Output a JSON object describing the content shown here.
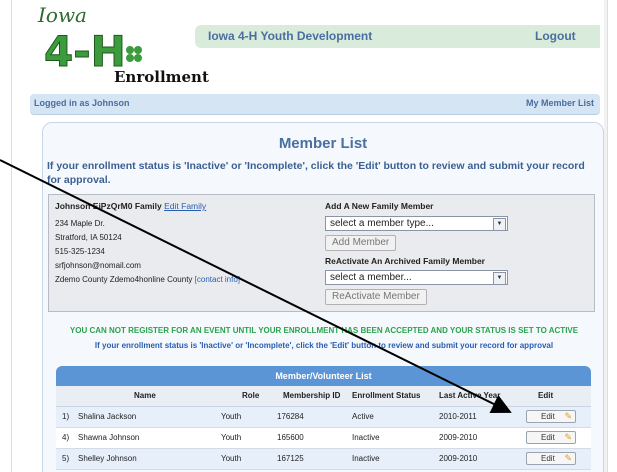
{
  "logo": {
    "state_word": "Iowa",
    "mark": "4-H",
    "word": "Enrollment"
  },
  "header": {
    "title": "Iowa 4-H Youth Development",
    "logout": "Logout"
  },
  "subbar": {
    "logged_in": "Logged in as Johnson",
    "my_member_list": "My Member List"
  },
  "main": {
    "title": "Member List",
    "instruction": "If your enrollment status is 'Inactive' or 'Incomplete', click the 'Edit' button to review and submit your record for approval."
  },
  "family": {
    "name": "Johnson EiPzQrM0 Family",
    "edit_link": "Edit Family",
    "address1": "234 Maple Dr.",
    "address2": "Stratford, IA 50124",
    "phone": "515-325-1234",
    "email": "srfjohnson@nomail.com",
    "county": "Zdemo County Zdemo4honline County",
    "contact_link": "[contact info]"
  },
  "add_member": {
    "title": "Add A New Family Member",
    "select_value": "select a member type...",
    "button": "Add Member"
  },
  "reactivate": {
    "title": "ReActivate An Archived Family Member",
    "select_value": "select a member...",
    "button": "ReActivate Member"
  },
  "warnings": {
    "line1": "YOU CAN NOT REGISTER FOR AN EVENT UNTIL YOUR ENROLLMENT HAS BEEN ACCEPTED AND YOUR STATUS IS SET TO ACTIVE",
    "line2": "If your enrollment status is 'Inactive' or 'Incomplete', click the 'Edit' button to review and submit your record for approval"
  },
  "table": {
    "title": "Member/Volunteer List",
    "headers": {
      "name": "Name",
      "role": "Role",
      "membership_id": "Membership ID",
      "status": "Enrollment Status",
      "last_year": "Last Active Year",
      "edit": "Edit"
    },
    "rows": [
      {
        "num": "1)",
        "name": "Shalina Jackson",
        "role": "Youth",
        "id": "176284",
        "status": "Active",
        "year": "2010-2011",
        "edit": "Edit"
      },
      {
        "num": "4)",
        "name": "Shawna Johnson",
        "role": "Youth",
        "id": "165600",
        "status": "Inactive",
        "year": "2009-2010",
        "edit": "Edit"
      },
      {
        "num": "5)",
        "name": "Shelley Johnson",
        "role": "Youth",
        "id": "167125",
        "status": "Inactive",
        "year": "2009-2010",
        "edit": "Edit"
      }
    ]
  },
  "colors": {
    "accent": "#4a6ea0",
    "table_header": "#5b95d6",
    "logo_green": "#2f8f2f",
    "warning_green": "#2aa34a"
  },
  "icons": {
    "edit": "pencil-icon",
    "dropdown": "chevron-down-icon"
  }
}
